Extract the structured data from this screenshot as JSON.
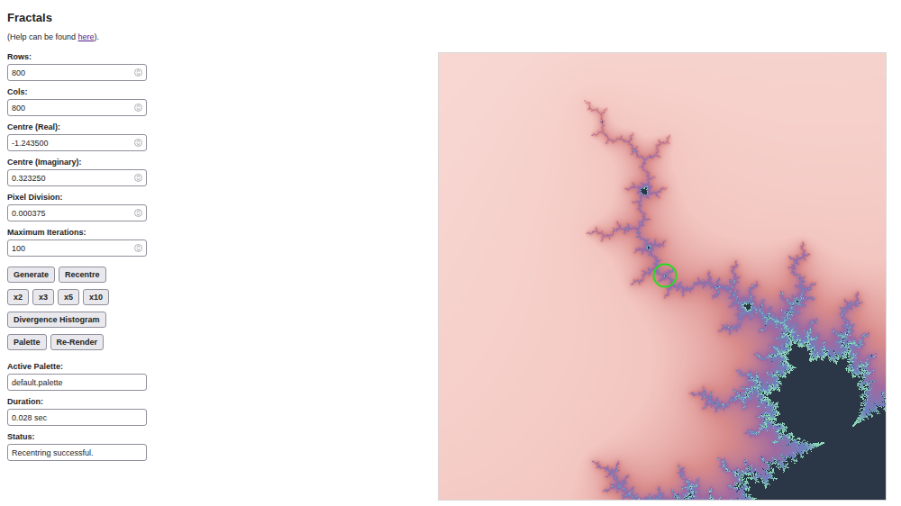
{
  "title": "Fractals",
  "help": {
    "prefix": "(Help can be found ",
    "link": "here",
    "suffix": ")."
  },
  "fields": [
    {
      "label": "Rows:",
      "value": "800",
      "kind": "number"
    },
    {
      "label": "Cols:",
      "value": "800",
      "kind": "number"
    },
    {
      "label": "Centre (Real):",
      "value": "-1.243500",
      "kind": "number"
    },
    {
      "label": "Centre (Imaginary):",
      "value": "0.323250",
      "kind": "number"
    },
    {
      "label": "Pixel Division:",
      "value": "0.000375",
      "kind": "number"
    },
    {
      "label": "Maximum Iterations:",
      "value": "100",
      "kind": "number"
    }
  ],
  "button_rows": [
    [
      "Generate",
      "Recentre"
    ],
    [
      "x2",
      "x3",
      "x5",
      "x10"
    ],
    [
      "Divergence Histogram"
    ],
    [
      "Palette",
      "Re-Render"
    ]
  ],
  "info_fields": [
    {
      "label": "Active Palette:",
      "value": "default.palette",
      "kind": "text"
    },
    {
      "label": "Duration:",
      "value": "0.028 sec",
      "kind": "text"
    },
    {
      "label": "Status:",
      "value": "Recentring successful.",
      "kind": "text"
    }
  ],
  "marker": {
    "shown": true
  }
}
